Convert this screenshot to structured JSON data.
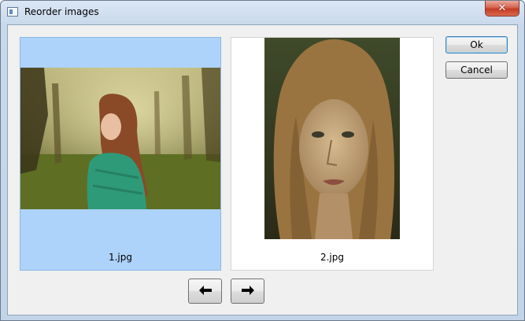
{
  "window": {
    "title": "Reorder images",
    "close_symbol": "✕"
  },
  "images": [
    {
      "filename": "1.jpg",
      "selected": true,
      "description_icon": "portrait-photo-icon"
    },
    {
      "filename": "2.jpg",
      "selected": false,
      "description_icon": "portrait-photo-icon"
    }
  ],
  "buttons": {
    "ok": "Ok",
    "cancel": "Cancel",
    "move_left_icon": "arrow-left-icon",
    "move_right_icon": "arrow-right-icon"
  },
  "colors": {
    "selection_background": "#add3fb",
    "client_background": "#f0f0f0"
  }
}
